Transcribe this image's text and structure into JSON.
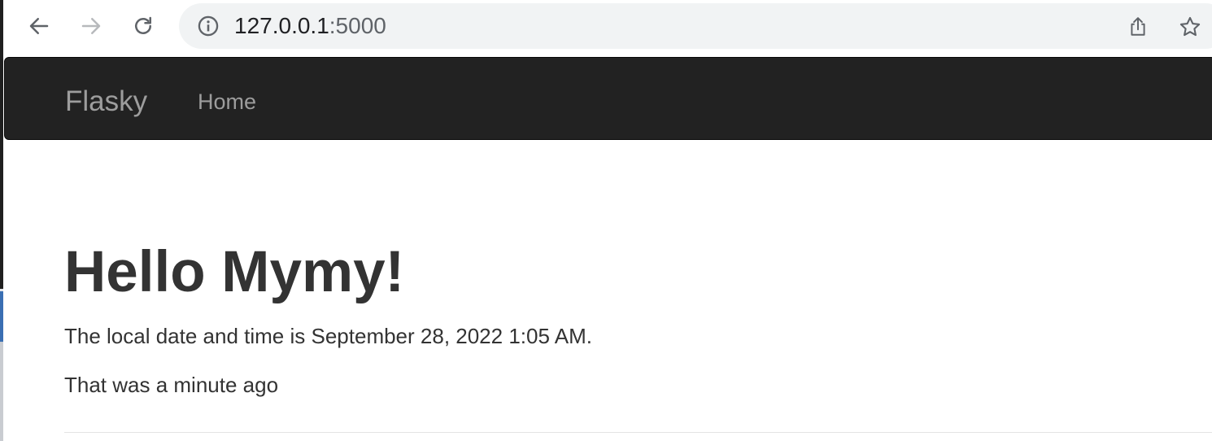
{
  "browser": {
    "url_host": "127.0.0.1",
    "url_port": ":5000",
    "icons": {
      "back": "arrow-left-icon",
      "forward": "arrow-right-icon",
      "reload": "reload-icon",
      "site_info": "info-icon",
      "share": "share-icon",
      "bookmark": "star-icon"
    }
  },
  "navbar": {
    "brand": "Flasky",
    "links": [
      {
        "label": "Home"
      }
    ],
    "background": "#222222",
    "text_color": "#9d9d9d"
  },
  "page": {
    "heading": "Hello Mymy!",
    "datetime_text": "The local date and time is September 28, 2022 1:05 AM.",
    "relative_text": "That was a minute ago"
  },
  "colors": {
    "omnibox": "#f1f3f4",
    "body_text": "#333333"
  }
}
